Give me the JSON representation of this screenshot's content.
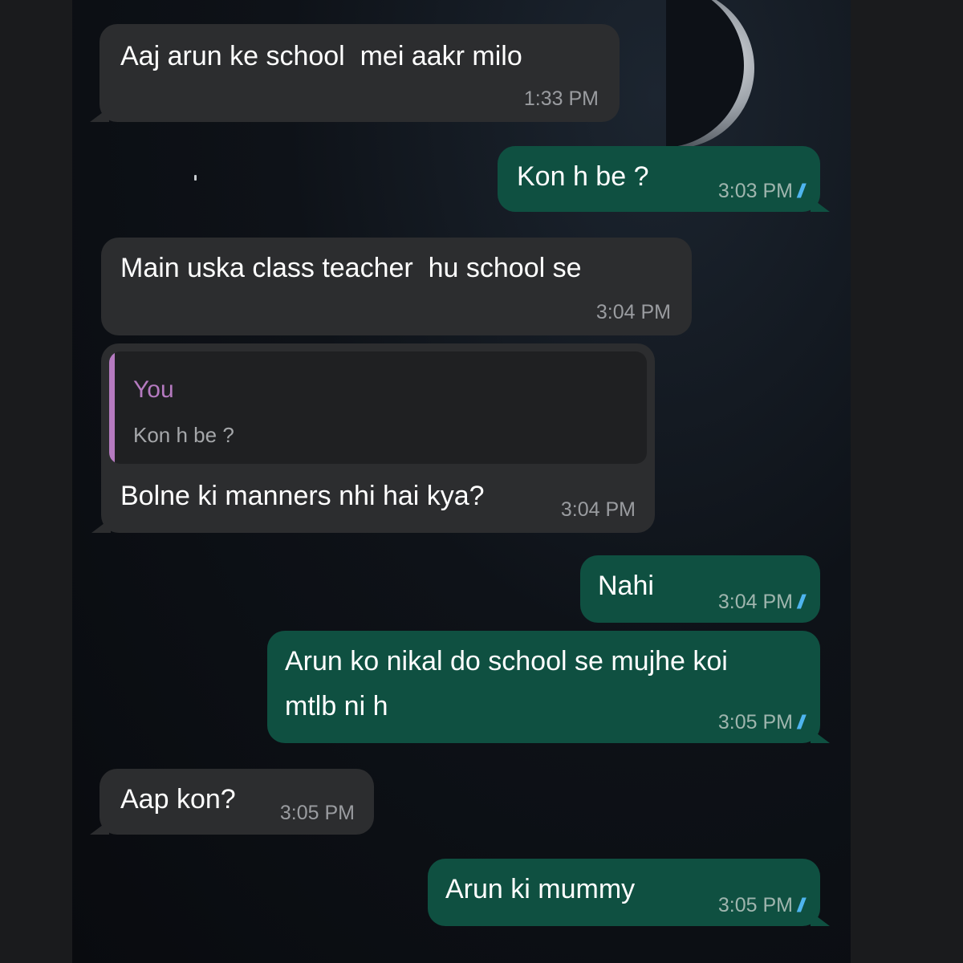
{
  "colors": {
    "incoming_bubble": "#2c2d2f",
    "outgoing_bubble": "#0f5041",
    "read_ticks": "#4fb5ef",
    "quote_accent": "#b57ac0"
  },
  "messages": [
    {
      "direction": "incoming",
      "text": "Aaj arun ke school  mei aakr milo",
      "time": "1:33 PM"
    },
    {
      "direction": "outgoing",
      "text": "Kon h be ?",
      "time": "3:03 PM",
      "status": "read"
    },
    {
      "direction": "incoming",
      "text": "Main uska class teacher  hu school se",
      "time": "3:04 PM"
    },
    {
      "direction": "incoming",
      "quoted": {
        "author": "You",
        "text": "Kon h be ?"
      },
      "text": "Bolne ki manners nhi hai kya?",
      "time": "3:04 PM"
    },
    {
      "direction": "outgoing",
      "text": "Nahi",
      "time": "3:04 PM",
      "status": "read"
    },
    {
      "direction": "outgoing",
      "text": "Arun ko nikal do school se mujhe koi\nmtlb ni h",
      "time": "3:05 PM",
      "status": "read"
    },
    {
      "direction": "incoming",
      "text": "Aap kon?",
      "time": "3:05 PM"
    },
    {
      "direction": "outgoing",
      "text": "Arun ki mummy",
      "time": "3:05 PM",
      "status": "read"
    }
  ]
}
